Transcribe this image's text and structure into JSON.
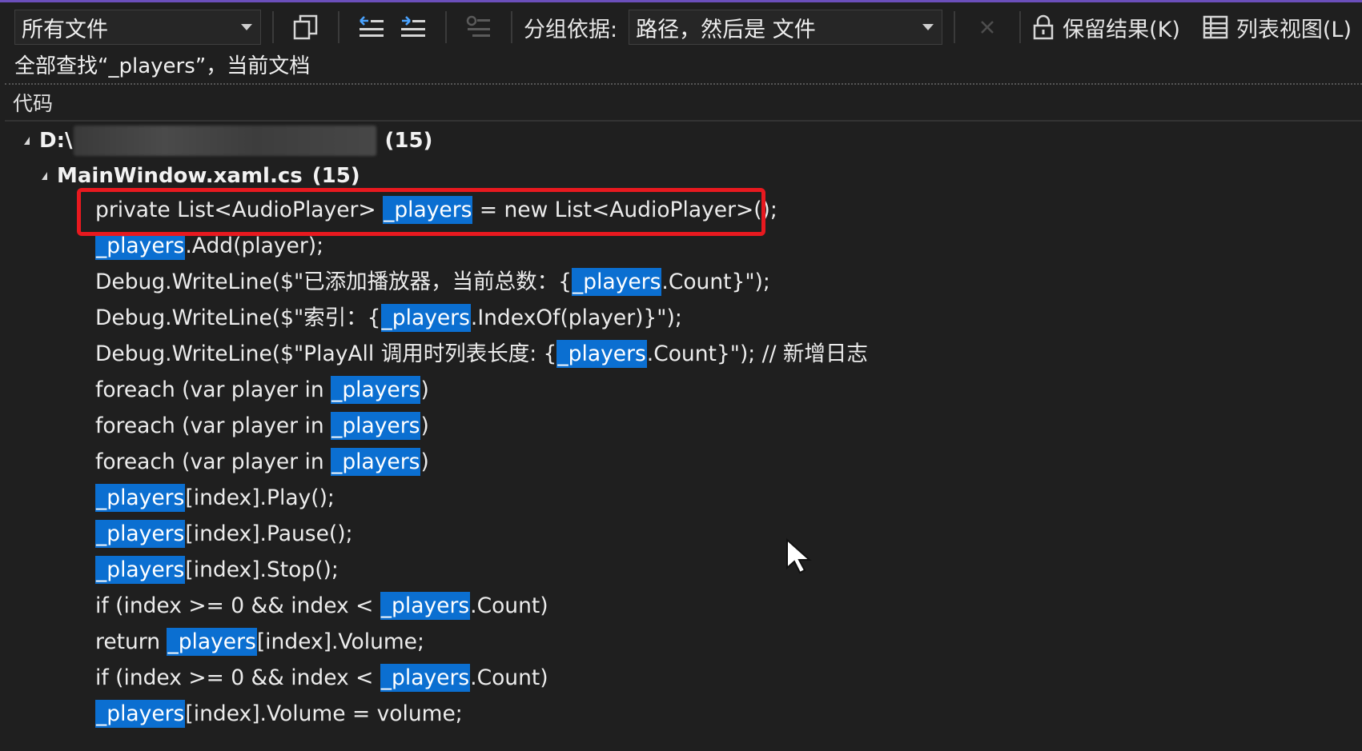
{
  "toolbar": {
    "scope_select": "所有文件",
    "group_by_label": "分组依据:",
    "group_by_select": "路径，然后是 文件",
    "keep_results": "保留结果(K)",
    "list_view": "列表视图(L)"
  },
  "status": "全部查找“_players”，当前文档",
  "column_header": "代码",
  "tree": {
    "root": {
      "prefix": "D:\\",
      "count": "(15)"
    },
    "file": {
      "name": "MainWindow.xaml.cs",
      "count": "(15)"
    }
  },
  "results": [
    [
      "private List<AudioPlayer> ",
      "_players",
      " = new List<AudioPlayer>();"
    ],
    [
      "",
      "_players",
      ".Add(player);"
    ],
    [
      "Debug.WriteLine($\"已添加播放器，当前总数：{",
      "_players",
      ".Count}\");"
    ],
    [
      "Debug.WriteLine($\"索引：{",
      "_players",
      ".IndexOf(player)}\");"
    ],
    [
      "Debug.WriteLine($\"PlayAll 调用时列表长度: {",
      "_players",
      ".Count}\"); // 新增日志"
    ],
    [
      "foreach (var player in ",
      "_players",
      ")"
    ],
    [
      "foreach (var player in ",
      "_players",
      ")"
    ],
    [
      "foreach (var player in ",
      "_players",
      ")"
    ],
    [
      "",
      "_players",
      "[index].Play();"
    ],
    [
      "",
      "_players",
      "[index].Pause();"
    ],
    [
      "",
      "_players",
      "[index].Stop();"
    ],
    [
      "if (index >= 0 && index < ",
      "_players",
      ".Count)"
    ],
    [
      "return ",
      "_players",
      "[index].Volume;"
    ],
    [
      "if (index >= 0 && index < ",
      "_players",
      ".Count)"
    ],
    [
      "",
      "_players",
      "[index].Volume = volume;"
    ]
  ],
  "colors": {
    "background": "#1f1f1f",
    "match_highlight": "#0b6fd1",
    "annotation_box": "#e8191f",
    "accent_topline": "#6b4fbb"
  },
  "icons": [
    "copy-icon",
    "indent-left-icon",
    "indent-right-icon",
    "filter-icon",
    "clear-icon",
    "lock-icon",
    "list-view-icon",
    "expand-triangle-icon",
    "mouse-cursor-icon"
  ]
}
